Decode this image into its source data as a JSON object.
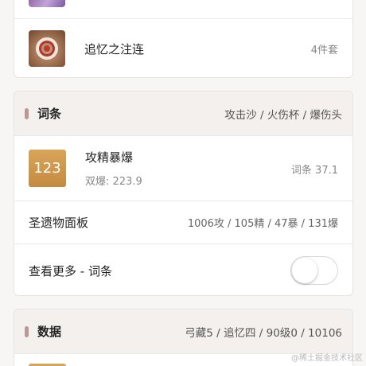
{
  "artifact_set": {
    "name": "追忆之注连",
    "count": "4件套"
  },
  "substats": {
    "title": "词条",
    "pieces": "攻击沙 / 火伤杯 / 爆伤头",
    "score": {
      "value": "123",
      "name": "攻精暴爆",
      "crit_value": "双爆: 223.9",
      "count": "词条 37.1"
    },
    "panel_label": "圣遗物面板",
    "panel_value": "1006攻 / 105精 / 47暴 / 131爆",
    "more_label": "查看更多 - 词条",
    "more_enabled": false
  },
  "data_section": {
    "title": "数据",
    "summary": "弓藏5 / 追忆四 / 90级0 / 10106"
  },
  "watermark": "@稀土掘金技术社区",
  "colors": {
    "badge": "#c48b3f",
    "header_bg": "#f3f0ed",
    "header_bar": "#b99a93"
  }
}
